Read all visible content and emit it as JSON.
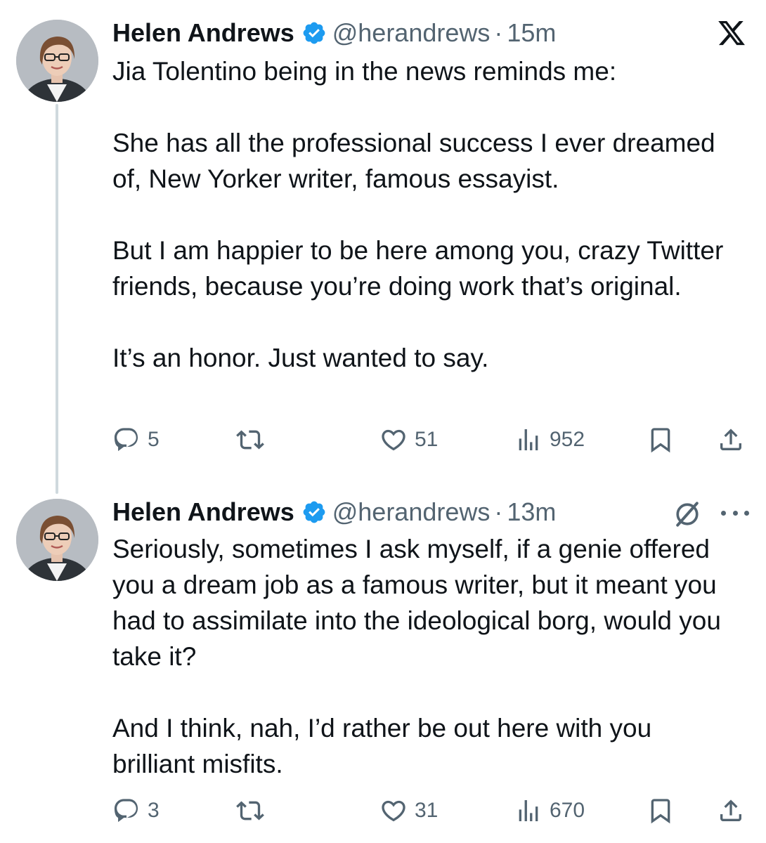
{
  "brand": {
    "icon": "x-logo-icon",
    "verified_color": "#1d9bf0",
    "text_color": "#0f1419",
    "muted_color": "#536471"
  },
  "tweets": [
    {
      "author_name": "Helen Andrews",
      "handle": "@herandrews",
      "separator": "·",
      "time": "15m",
      "paragraphs": [
        "Jia Tolentino being in the news reminds me:",
        "She has all the professional success I ever dreamed of, New Yorker writer,  famous essayist.",
        "But I am happier to be here among you, crazy Twitter friends, because you’re doing work that’s original.",
        "It’s an honor. Just wanted to say."
      ],
      "replies": "5",
      "likes": "51",
      "views": "952"
    },
    {
      "author_name": "Helen Andrews",
      "handle": "@herandrews",
      "separator": "·",
      "time": "13m",
      "paragraphs": [
        "Seriously, sometimes I ask myself, if a genie offered you a dream job as a famous writer, but it meant you had to assimilate into the ideological borg, would you take it?",
        "And I think, nah, I’d rather be out here with you brilliant misfits."
      ],
      "replies": "3",
      "likes": "31",
      "views": "670"
    }
  ]
}
